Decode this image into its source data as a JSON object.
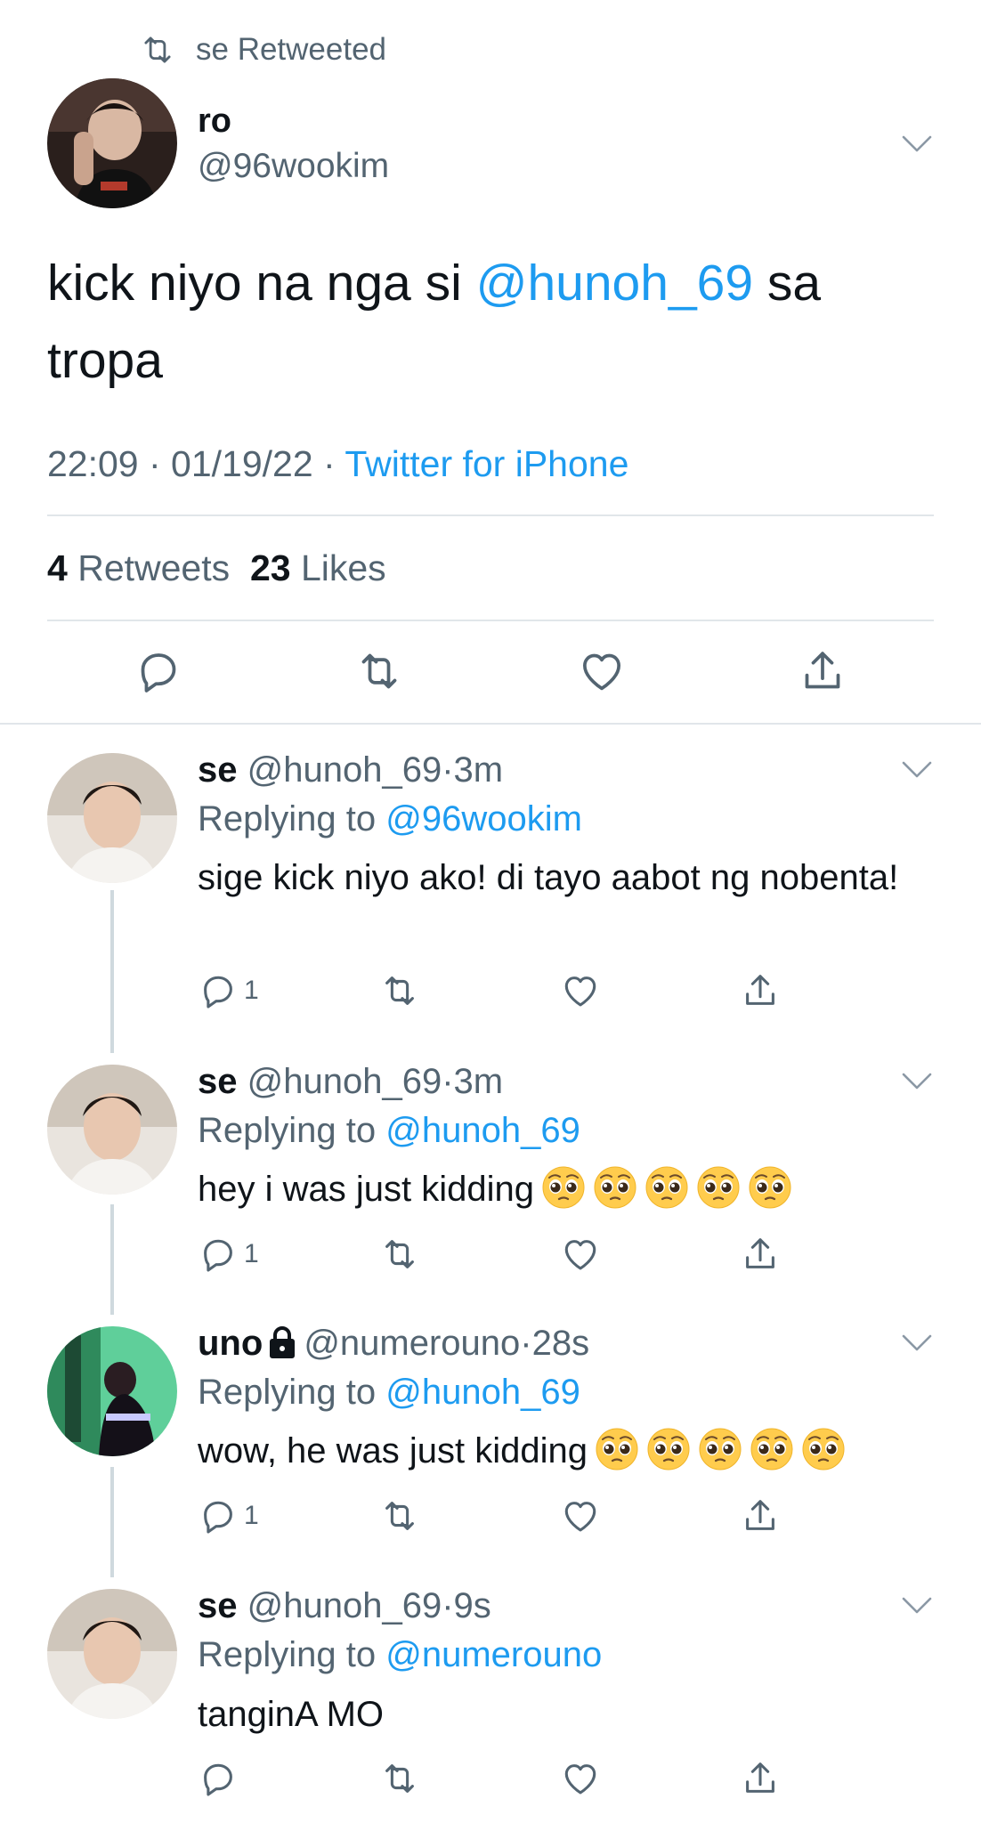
{
  "retweet_banner": {
    "text": "se Retweeted",
    "icon": "retweet-icon"
  },
  "main_tweet": {
    "name": "ro",
    "handle": "@96wookim",
    "text_before": "kick niyo na nga si ",
    "mention": "@hunoh_69",
    "text_after": " sa tropa",
    "time": "22:09",
    "date": "01/19/22",
    "source": "Twitter for iPhone",
    "separator": " · ",
    "retweets_count": "4",
    "retweets_label": "Retweets",
    "likes_count": "23",
    "likes_label": "Likes"
  },
  "replies": [
    {
      "name": "se",
      "handle": "@hunoh_69",
      "dot": "·",
      "time": "3m",
      "replying_label": "Replying to",
      "replying_to": "@96wookim",
      "text": "sige kick niyo ako! di tayo aabot ng nobenta!",
      "reply_count": "1"
    },
    {
      "name": "se",
      "handle": "@hunoh_69",
      "dot": "·",
      "time": "3m",
      "replying_label": "Replying to",
      "replying_to": "@hunoh_69",
      "text": "hey i was just kidding",
      "emoji": "pleading-face-emoji x5",
      "reply_count": "1"
    },
    {
      "name": "uno",
      "handle": "@numerouno",
      "dot": "·",
      "time": "28s",
      "replying_label": "Replying to",
      "replying_to": "@hunoh_69",
      "text": "wow, he was just kidding",
      "emoji": "pleading-face-emoji x5",
      "reply_count": "1",
      "protected_icon": "lock-icon"
    },
    {
      "name": "se",
      "handle": "@hunoh_69",
      "dot": "·",
      "time": "9s",
      "replying_label": "Replying to",
      "replying_to": "@numerouno",
      "text": "tanginA MO",
      "reply_count": ""
    }
  ],
  "colors": {
    "link": "#1d9bf0",
    "secondary_text": "#536471",
    "primary_text": "#0f1419",
    "divider": "#e1e6ea"
  }
}
